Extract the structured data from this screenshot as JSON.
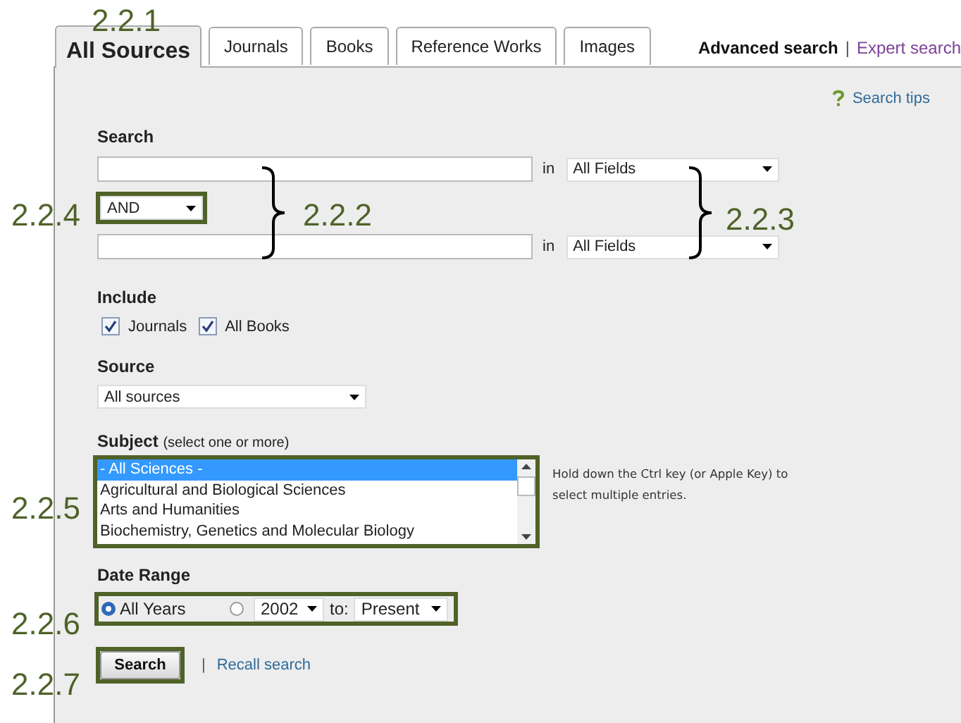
{
  "annotations": [
    {
      "label": "2.2.1"
    },
    {
      "label": "2.2.4"
    },
    {
      "label": "2.2.2"
    },
    {
      "label": "2.2.3"
    },
    {
      "label": "2.2.5"
    },
    {
      "label": "2.2.6"
    },
    {
      "label": "2.2.7"
    }
  ],
  "tabs": [
    {
      "label": "All Sources",
      "selected": true
    },
    {
      "label": "Journals",
      "selected": false
    },
    {
      "label": "Books",
      "selected": false
    },
    {
      "label": "Reference Works",
      "selected": false
    },
    {
      "label": "Images",
      "selected": false
    }
  ],
  "header_links": {
    "current": "Advanced search",
    "separator": "|",
    "other": "Expert search"
  },
  "search_tips": "Search tips",
  "search": {
    "label": "Search",
    "operator": "AND",
    "terms": [
      {
        "in_label": "in",
        "field": "All Fields"
      },
      {
        "in_label": "in",
        "field": "All Fields"
      }
    ]
  },
  "include": {
    "label": "Include",
    "options": [
      {
        "label": "Journals",
        "checked": true
      },
      {
        "label": "All Books",
        "checked": true
      }
    ]
  },
  "source": {
    "label": "Source",
    "value": "All sources"
  },
  "subject": {
    "label": "Subject",
    "hint": "(select one or more)",
    "help": "Hold down the Ctrl key (or Apple Key) to select multiple entries.",
    "options": [
      {
        "label": "- All Sciences -",
        "selected": true
      },
      {
        "label": "Agricultural and Biological Sciences",
        "selected": false
      },
      {
        "label": "Arts and Humanities",
        "selected": false
      },
      {
        "label": "Biochemistry, Genetics and Molecular Biology",
        "selected": false
      }
    ]
  },
  "date_range": {
    "label": "Date Range",
    "options": [
      {
        "label": "All Years",
        "selected": true
      },
      {
        "from": "2002",
        "to_label": "to:",
        "to": "Present",
        "selected": false
      }
    ]
  },
  "actions": {
    "search_button": "Search",
    "separator": "|",
    "recall_link": "Recall search"
  }
}
